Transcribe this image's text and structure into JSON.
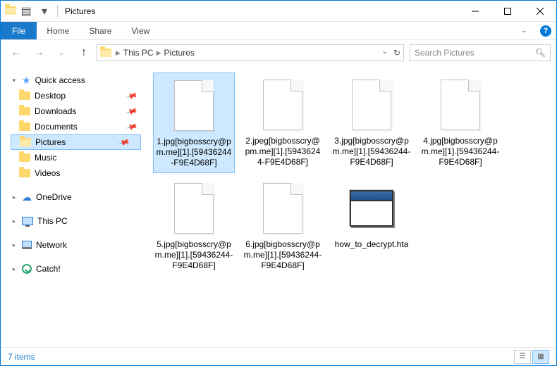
{
  "window": {
    "title": "Pictures"
  },
  "ribbon": {
    "file": "File",
    "tabs": [
      "Home",
      "Share",
      "View"
    ]
  },
  "breadcrumb": {
    "parts": [
      "This PC",
      "Pictures"
    ]
  },
  "search": {
    "placeholder": "Search Pictures"
  },
  "sidebar": {
    "quick_access": {
      "label": "Quick access",
      "children": [
        {
          "label": "Desktop",
          "pinned": true
        },
        {
          "label": "Downloads",
          "pinned": true
        },
        {
          "label": "Documents",
          "pinned": true
        },
        {
          "label": "Pictures",
          "pinned": true,
          "selected": true
        },
        {
          "label": "Music",
          "pinned": false
        },
        {
          "label": "Videos",
          "pinned": false
        }
      ]
    },
    "roots": [
      {
        "label": "OneDrive"
      },
      {
        "label": "This PC"
      },
      {
        "label": "Network"
      },
      {
        "label": "Catch!"
      }
    ]
  },
  "files": [
    {
      "name": "1.jpg[bigbosscry@pm.me][1].[59436244-F9E4D68F]",
      "icon": "blank",
      "selected": true
    },
    {
      "name": "2.jpeg[bigbosscry@pm.me][1].[59436244-F9E4D68F]",
      "icon": "blank"
    },
    {
      "name": "3.jpg[bigbosscry@pm.me][1].[59436244-F9E4D68F]",
      "icon": "blank"
    },
    {
      "name": "4.jpg[bigbosscry@pm.me][1].[59436244-F9E4D68F]",
      "icon": "blank"
    },
    {
      "name": "5.jpg[bigbosscry@pm.me][1].[59436244-F9E4D68F]",
      "icon": "blank"
    },
    {
      "name": "6.jpg[bigbosscry@pm.me][1].[59436244-F9E4D68F]",
      "icon": "blank"
    },
    {
      "name": "how_to_decrypt.hta",
      "icon": "hta"
    }
  ],
  "status": {
    "count_label": "7 items"
  }
}
